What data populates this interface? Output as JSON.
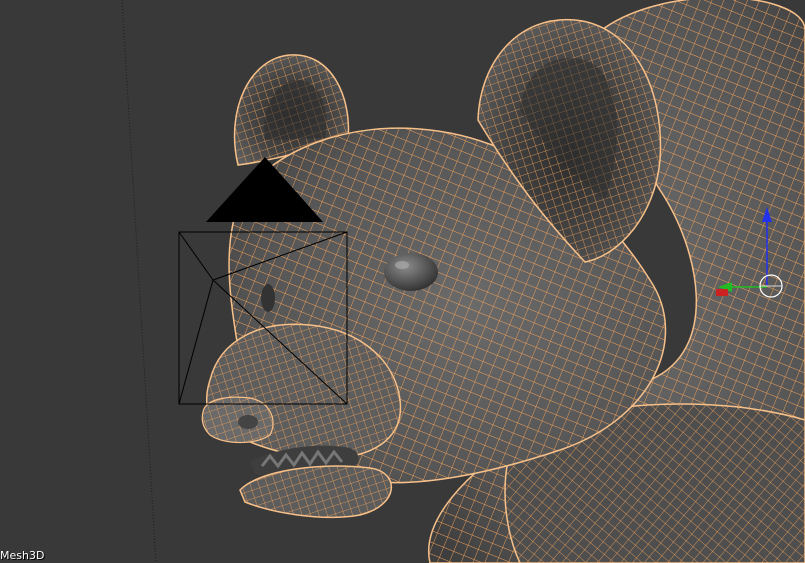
{
  "viewport": {
    "object_name": "Mesh3D",
    "background_color": "#393939",
    "mesh_surface_color": "#595959",
    "wireframe_color": "#f2a25a",
    "camera_outline_color": "#000000",
    "gizmo": {
      "x_axis_color": "#cc2222",
      "y_axis_color": "#22bb22",
      "z_axis_color": "#2233ee"
    }
  }
}
